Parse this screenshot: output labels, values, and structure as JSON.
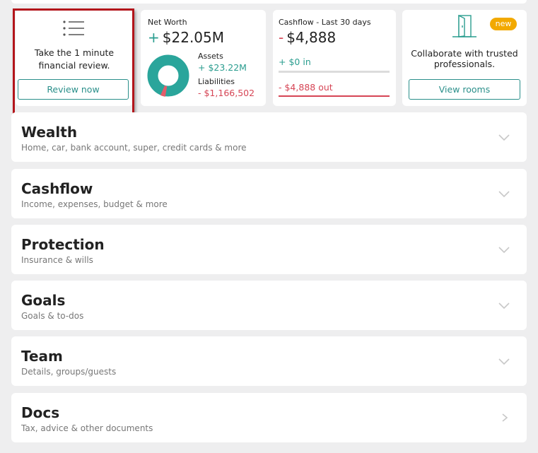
{
  "review_card": {
    "icon": "list-icon",
    "text": "Take the 1 minute financial review.",
    "button_label": "Review now"
  },
  "net_worth": {
    "label": "Net Worth",
    "sign": "+",
    "value": "$22.05M",
    "assets_label": "Assets",
    "assets_value": "+ $23.22M",
    "liabilities_label": "Liabilities",
    "liabilities_value": "- $1,166,502",
    "colors": {
      "assets": "#2a9d8f",
      "liabilities": "#d64555"
    }
  },
  "cashflow": {
    "label": "Cashflow - Last 30 days",
    "sign": "-",
    "value": "$4,888",
    "in_value": "+ $0",
    "in_label": "in",
    "out_value": "- $4,888",
    "out_label": "out"
  },
  "rooms_card": {
    "icon": "door-icon",
    "badge": "new",
    "text": "Collaborate with trusted professionals.",
    "button_label": "View rooms"
  },
  "sections": [
    {
      "title": "Wealth",
      "subtitle": "Home, car, bank account, super, credit cards & more",
      "icon": "chevron-down-icon"
    },
    {
      "title": "Cashflow",
      "subtitle": "Income, expenses, budget & more",
      "icon": "chevron-down-icon"
    },
    {
      "title": "Protection",
      "subtitle": "Insurance & wills",
      "icon": "chevron-down-icon"
    },
    {
      "title": "Goals",
      "subtitle": "Goals & to-dos",
      "icon": "chevron-down-icon"
    },
    {
      "title": "Team",
      "subtitle": "Details, groups/guests",
      "icon": "chevron-down-icon"
    },
    {
      "title": "Docs",
      "subtitle": "Tax, advice & other documents",
      "icon": "chevron-right-icon"
    }
  ]
}
